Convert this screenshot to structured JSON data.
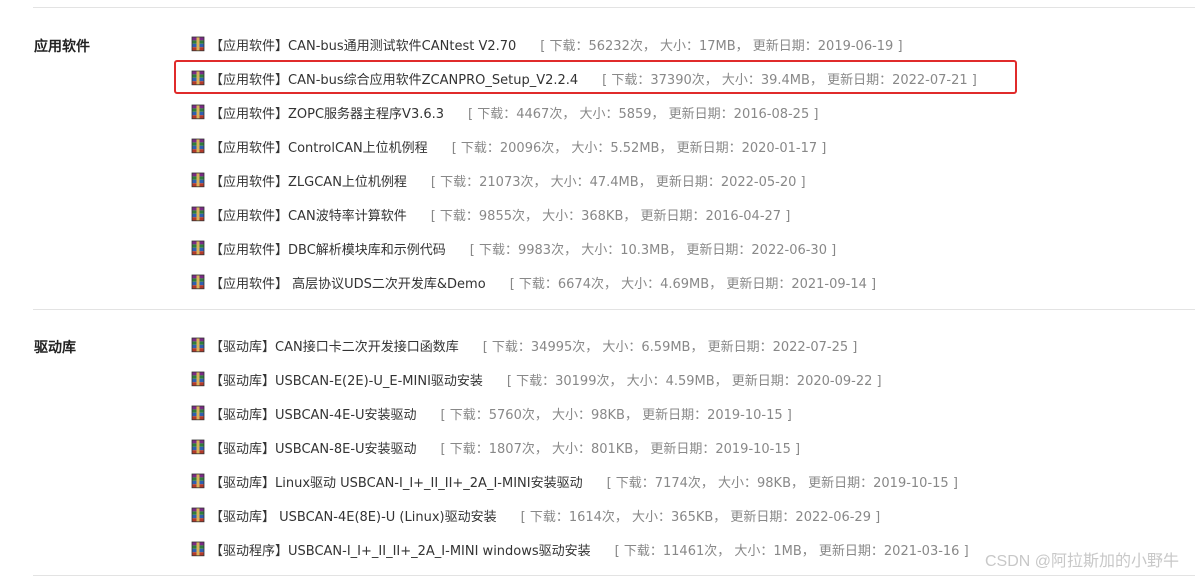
{
  "sections": [
    {
      "title": "应用软件",
      "items": [
        {
          "name": "【应用软件】CAN-bus通用测试软件CANtest V2.70",
          "meta": "[ 下载：56232次，  大小：17MB，  更新日期：2019-06-19 ]"
        },
        {
          "name": "【应用软件】CAN-bus综合应用软件ZCANPRO_Setup_V2.2.4",
          "meta": "[ 下载：37390次，  大小：39.4MB，  更新日期：2022-07-21 ]"
        },
        {
          "name": "【应用软件】ZOPC服务器主程序V3.6.3",
          "meta": "[ 下载：4467次，  大小：5859，  更新日期：2016-08-25 ]"
        },
        {
          "name": "【应用软件】ControlCAN上位机例程",
          "meta": "[ 下载：20096次，  大小：5.52MB，  更新日期：2020-01-17 ]"
        },
        {
          "name": "【应用软件】ZLGCAN上位机例程",
          "meta": "[ 下载：21073次，  大小：47.4MB，  更新日期：2022-05-20 ]"
        },
        {
          "name": "【应用软件】CAN波特率计算软件",
          "meta": "[ 下载：9855次，  大小：368KB，  更新日期：2016-04-27 ]"
        },
        {
          "name": "【应用软件】DBC解析模块库和示例代码",
          "meta": "[ 下载：9983次，  大小：10.3MB，  更新日期：2022-06-30 ]"
        },
        {
          "name": "【应用软件】 高层协议UDS二次开发库&Demo",
          "meta": "[ 下载：6674次，  大小：4.69MB，  更新日期：2021-09-14 ]"
        }
      ]
    },
    {
      "title": "驱动库",
      "items": [
        {
          "name": "【驱动库】CAN接口卡二次开发接口函数库",
          "meta": "[ 下载：34995次，  大小：6.59MB，  更新日期：2022-07-25 ]"
        },
        {
          "name": "【驱动库】USBCAN-E(2E)-U_E-MINI驱动安装",
          "meta": "[ 下载：30199次，  大小：4.59MB，  更新日期：2020-09-22 ]"
        },
        {
          "name": "【驱动库】USBCAN-4E-U安装驱动",
          "meta": "[ 下载：5760次，  大小：98KB，  更新日期：2019-10-15 ]"
        },
        {
          "name": "【驱动库】USBCAN-8E-U安装驱动",
          "meta": "[ 下载：1807次，  大小：801KB，  更新日期：2019-10-15 ]"
        },
        {
          "name": "【驱动库】Linux驱动 USBCAN-I_I+_II_II+_2A_I-MINI安装驱动",
          "meta": "[ 下载：7174次，  大小：98KB，  更新日期：2019-10-15 ]"
        },
        {
          "name": "【驱动库】 USBCAN-4E(8E)-U (Linux)驱动安装",
          "meta": "[ 下载：1614次，  大小：365KB，  更新日期：2022-06-29 ]"
        },
        {
          "name": "【驱动程序】USBCAN-I_I+_II_II+_2A_I-MINI windows驱动安装",
          "meta": "[ 下载：11461次，  大小：1MB，  更新日期：2021-03-16 ]"
        }
      ]
    }
  ],
  "watermark": "CSDN @阿拉斯加的小野牛",
  "colors": {
    "highlight_border": "#e02b2b",
    "meta_text": "#888888",
    "divider": "#e3e3e3"
  },
  "icons": {
    "file": "rar-archive-icon"
  }
}
